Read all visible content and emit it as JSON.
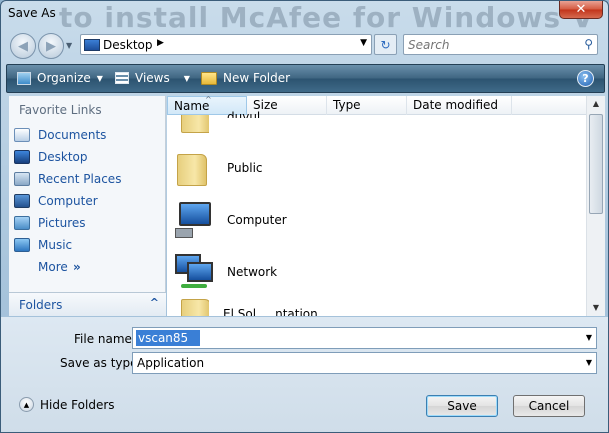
{
  "window": {
    "title": "Save As",
    "close_label": "✕",
    "background_text": "to install McAfee for Windows V"
  },
  "address_bar": {
    "location": "Desktop",
    "icon": "desktop-icon",
    "search_placeholder": "Search"
  },
  "toolbar": {
    "organize_label": "Organize",
    "views_label": "Views",
    "new_folder_label": "New Folder",
    "help_label": "?"
  },
  "navigation": {
    "heading": "Favorite Links",
    "items": [
      {
        "label": "Documents",
        "icon": "documents-icon"
      },
      {
        "label": "Desktop",
        "icon": "desktop-icon"
      },
      {
        "label": "Recent Places",
        "icon": "recent-places-icon"
      },
      {
        "label": "Computer",
        "icon": "computer-icon"
      },
      {
        "label": "Pictures",
        "icon": "pictures-icon"
      },
      {
        "label": "Music",
        "icon": "music-icon"
      }
    ],
    "more_label": "More",
    "more_arrow": "»",
    "folders_label": "Folders",
    "folders_chevron": "^"
  },
  "file_list": {
    "columns": [
      "Name",
      "Size",
      "Type",
      "Date modified"
    ],
    "sort_indicator": "^",
    "partial_top_item": "duyul",
    "items": [
      {
        "name": "Public",
        "icon": "folder-icon"
      },
      {
        "name": "Computer",
        "icon": "computer-icon"
      },
      {
        "name": "Network",
        "icon": "network-icon"
      }
    ],
    "partial_bottom_item": "El Sol ... ntation"
  },
  "form": {
    "file_name_label": "File name:",
    "file_name_value": "vscan85",
    "save_as_type_label": "Save as type:",
    "save_as_type_value": "Application"
  },
  "footer": {
    "hide_folders_label": "Hide Folders",
    "save_label": "Save",
    "cancel_label": "Cancel"
  },
  "colors": {
    "accent": "#3a7fd6",
    "toolbar": "#3e6581",
    "link": "#1d54a0",
    "close_button": "#c1331a"
  }
}
